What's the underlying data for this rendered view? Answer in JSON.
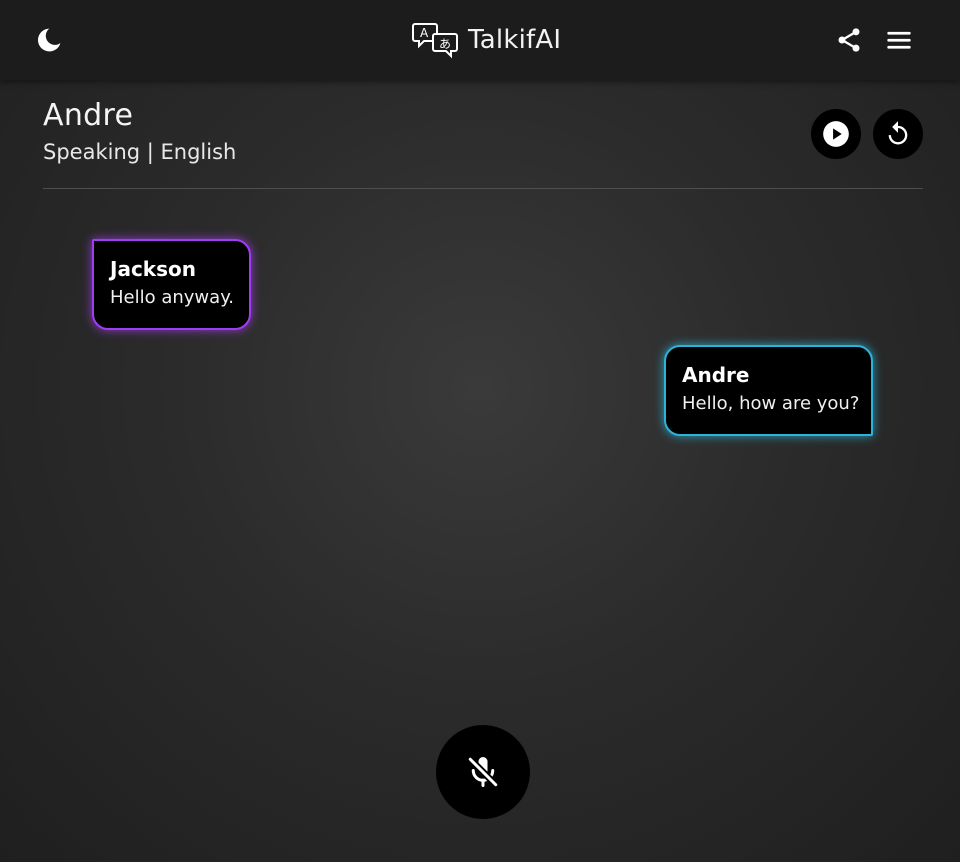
{
  "header": {
    "app_name": "TalkifAI",
    "icons": {
      "theme": "moon-icon",
      "logo": "translate-chat-icon",
      "share": "share-icon",
      "menu": "hamburger-menu-icon"
    }
  },
  "speaker": {
    "name": "Andre",
    "status": "Speaking | English",
    "controls": {
      "play": "play-icon",
      "reset": "replay-icon"
    }
  },
  "messages": [
    {
      "sender": "Jackson",
      "text": "Hello anyway.",
      "side": "left",
      "accent": "#a23cf0"
    },
    {
      "sender": "Andre",
      "text": "Hello, how are you?",
      "side": "right",
      "accent": "#2cb4d8"
    }
  ],
  "mic": {
    "state": "muted",
    "icon": "mic-off-icon"
  },
  "colors": {
    "topbar": "#1c1c1c",
    "background": "#2b2b2b",
    "bubble": "#000000",
    "accent_left": "#a23cf0",
    "accent_right": "#2cb4d8"
  }
}
